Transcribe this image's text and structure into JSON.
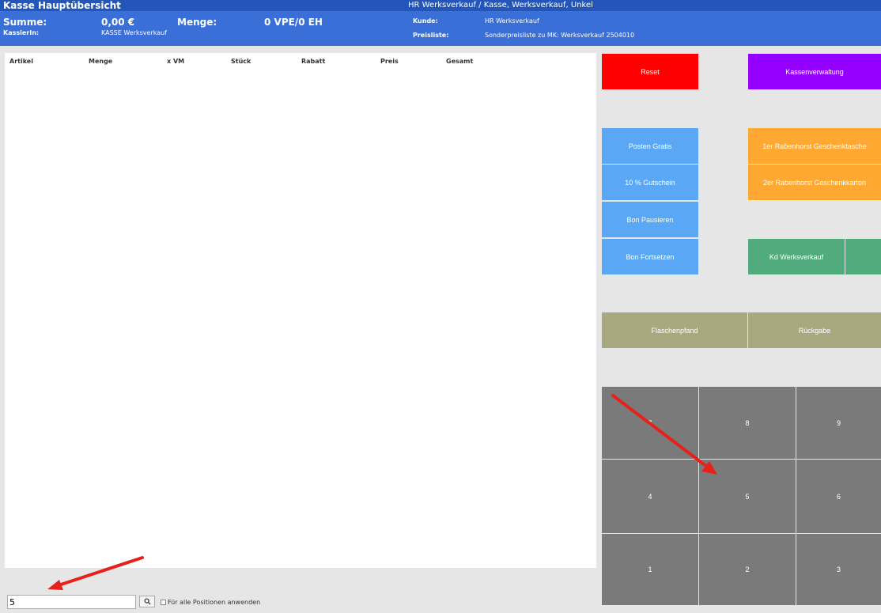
{
  "header": {
    "title": "Kasse Hauptübersicht",
    "subtitle": "HR Werksverkauf / Kasse, Werksverkauf, Unkel"
  },
  "info": {
    "summe_label": "Summe:",
    "summe_value": "0,00 €",
    "menge_label": "Menge:",
    "menge_value": "0 VPE/0 EH",
    "kassierin_label": "KassierIn:",
    "kassierin_value": "KASSE Werksverkauf",
    "kunde_label": "Kunde:",
    "kunde_value": "HR Werksverkauf",
    "preisliste_label": "Preisliste:",
    "preisliste_value": "Sonderpreisliste zu MK: Werksverkauf 2504010"
  },
  "table": {
    "columns": [
      "Artikel",
      "Menge",
      "x VM",
      "Stück",
      "Rabatt",
      "Preis",
      "Gesamt"
    ]
  },
  "buttons": {
    "reset": "Reset",
    "kassenverwaltung": "Kassenverwaltung",
    "posten_gratis": "Posten Gratis",
    "gutschein": "10 % Gutschein",
    "bon_pausieren": "Bon Pausieren",
    "bon_fortsetzen": "Bon Fortsetzen",
    "geschenktasche": "1er Rabenhorst Geschenktasche",
    "geschenkkarton": "2er Rabenhorst Geschenkkarton",
    "kd_werksverkauf": "Kd Werksverkauf",
    "flaschenpfand": "Flaschenpfand",
    "rueckgabe": "Rückgabe"
  },
  "keypad": [
    "7",
    "8",
    "9",
    "4",
    "5",
    "6",
    "1",
    "2",
    "3"
  ],
  "entry": {
    "value": "5",
    "apply_all_label": "Für alle Positionen anwenden"
  },
  "icons": {
    "search": "search-icon",
    "checkbox": "checkbox-icon"
  },
  "colors": {
    "title_bar": "#2356b8",
    "info_bar": "#3a6fd8",
    "reset": "#ff0000",
    "kassenverwaltung": "#9400ff",
    "blue_buttons": "#5aa8f5",
    "orange_buttons": "#ffa832",
    "green_buttons": "#52ab7c",
    "khaki_buttons": "#a8a97e",
    "keypad": "#7a7a7a",
    "annotation_arrow": "#e8201a"
  }
}
